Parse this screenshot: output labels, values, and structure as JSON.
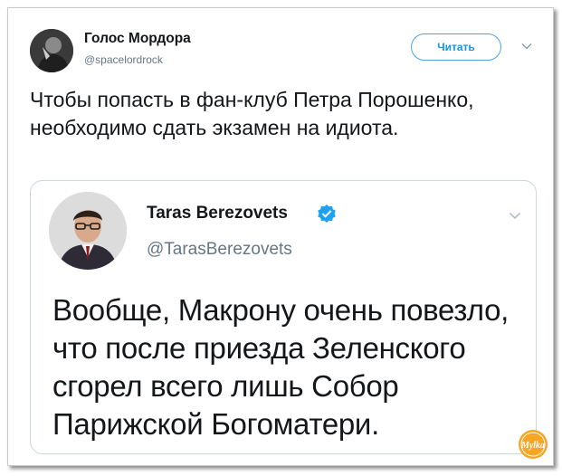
{
  "tweet": {
    "author_name": "Голос Мордора",
    "author_handle": "@spacelordrock",
    "follow_label": "Читать",
    "text": "Чтобы попасть в фан-клуб Петра Порошенко, необходимо сдать экзамен на идиота."
  },
  "quoted": {
    "author_name": "Taras Berezovets",
    "author_handle": "@TarasBerezovets",
    "text": "Вообще, Макрону очень повезло, что после приезда Зеленского сгорел всего лишь Собор Парижской Богоматери."
  },
  "watermark": {
    "text": "Mylka"
  },
  "colors": {
    "accent": "#1da1f2",
    "text": "#14171a",
    "muted": "#657786",
    "border": "#ccd6dd",
    "watermark": "#f5a623"
  },
  "icons": {
    "follow_caret": "chevron-down-icon",
    "verified": "verified-badge-icon",
    "quote_caret": "chevron-down-icon"
  }
}
